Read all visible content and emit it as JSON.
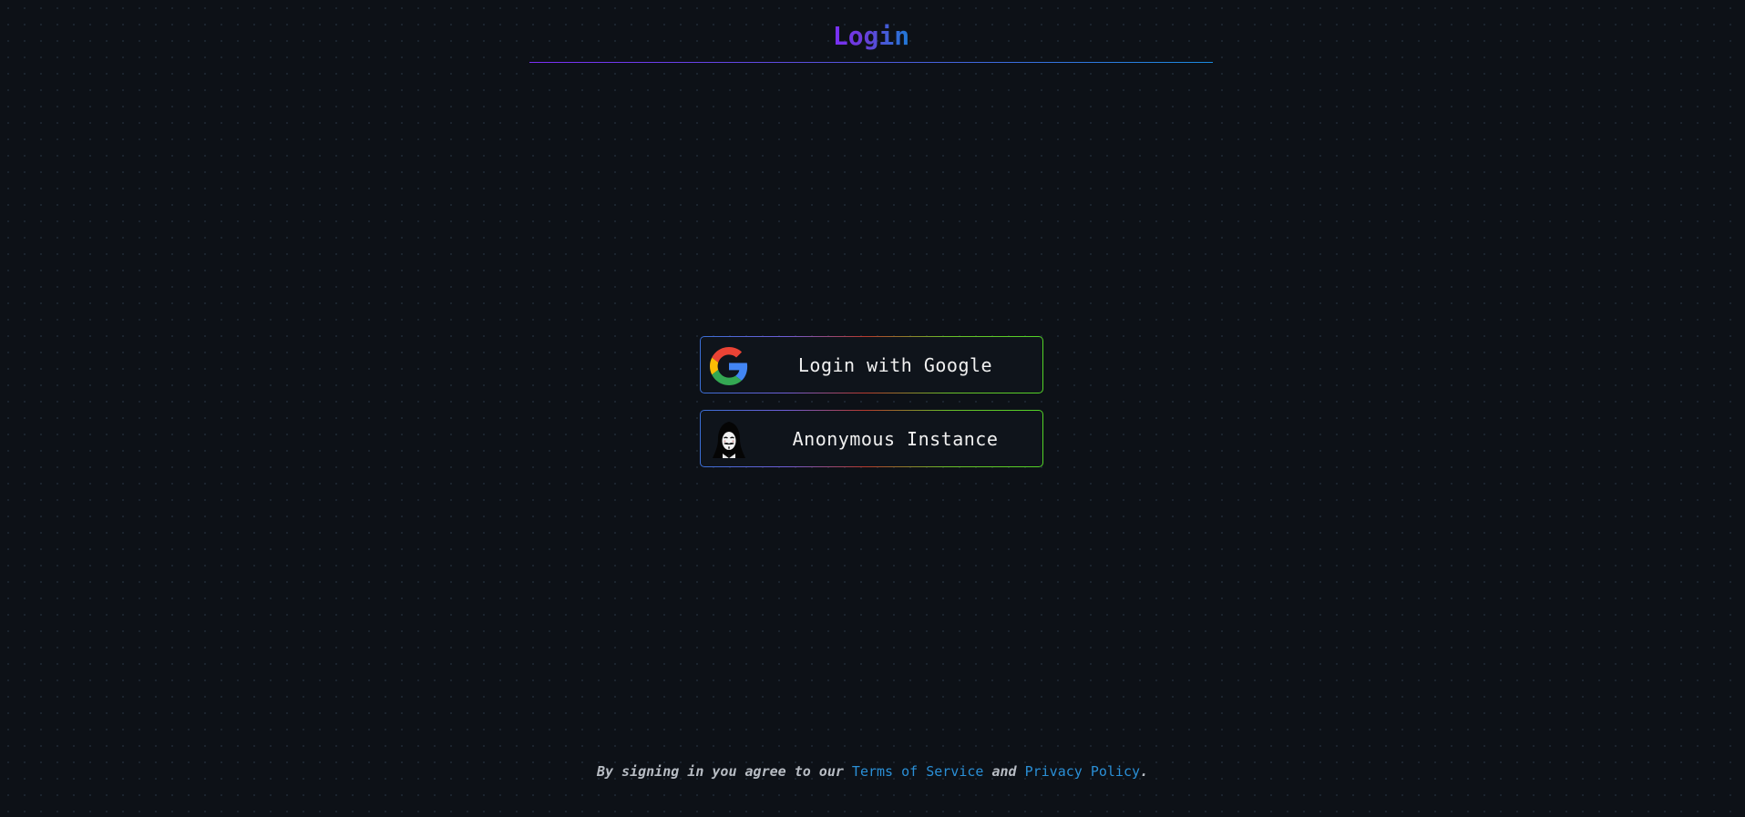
{
  "header": {
    "title": "Login"
  },
  "buttons": [
    {
      "label": "Login with Google",
      "icon": "google-icon"
    },
    {
      "label": "Anonymous Instance",
      "icon": "anonymous-mask-icon"
    }
  ],
  "footer": {
    "prefix": "By signing in you agree to our",
    "terms_link": "Terms of Service",
    "conjunction": "and",
    "privacy_link": "Privacy Policy",
    "suffix": "."
  },
  "colors": {
    "background": "#0d1117",
    "title_gradient_start": "#7b2ff7",
    "title_gradient_end": "#1f7ad6",
    "link": "#2a8fd6",
    "button_border_green": "#52d327",
    "button_border_blue": "#3b6fd6"
  }
}
